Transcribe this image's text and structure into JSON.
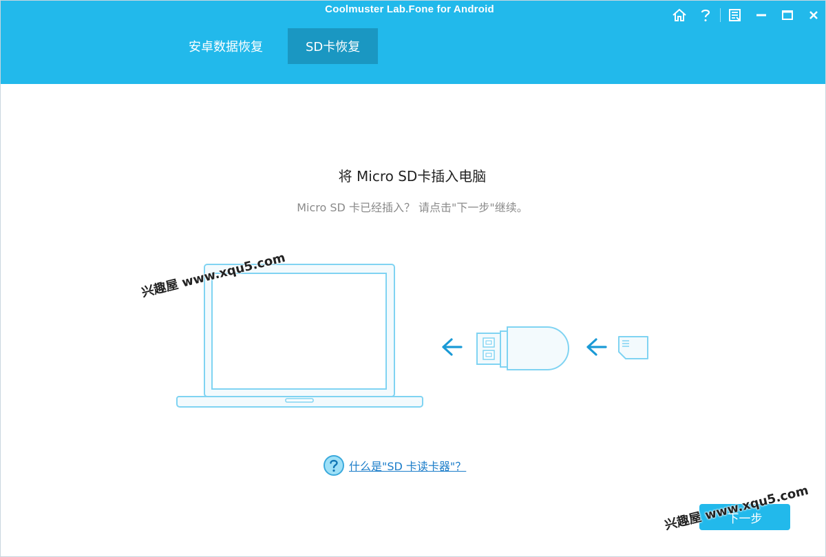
{
  "window": {
    "title": "Coolmuster Lab.Fone for Android",
    "controls": [
      "home-icon",
      "help-icon",
      "feedback-icon",
      "minimize-icon",
      "maximize-icon",
      "close-icon"
    ]
  },
  "tabs": [
    {
      "label": "安卓数据恢复",
      "active": false
    },
    {
      "label": "SD卡恢复",
      "active": true
    }
  ],
  "main": {
    "title": "将 Micro SD卡插入电脑",
    "subtitle": "Micro SD 卡已经插入？ 请点击\"下一步\"继续。",
    "help_link": "什么是\"SD 卡读卡器\"？",
    "next_button": "下一步"
  },
  "watermarks": [
    "兴趣屋 www.xqu5.com",
    "兴趣屋 www.xqu5.com"
  ],
  "colors": {
    "header": "#22b9eb",
    "active_tab": "#1a97c2",
    "illustration_stroke": "#7fd3f2",
    "arrow": "#1a9ad6",
    "link": "#1a7cc9"
  }
}
